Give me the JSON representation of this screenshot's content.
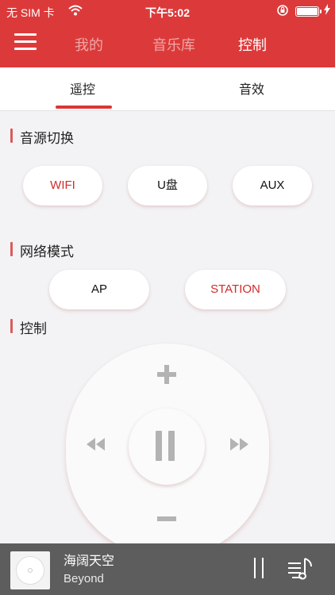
{
  "status_bar": {
    "carrier": "无 SIM 卡",
    "time": "下午5:02"
  },
  "top_nav": {
    "tabs": [
      "我的",
      "音乐库",
      "控制"
    ],
    "active_tab": "控制"
  },
  "sub_tabs": {
    "items": [
      "遥控",
      "音效"
    ],
    "active": "遥控"
  },
  "sections": {
    "source": {
      "title": "音源切换",
      "buttons": [
        "WIFI",
        "U盘",
        "AUX"
      ],
      "selected": "WIFI"
    },
    "network": {
      "title": "网络模式",
      "buttons": [
        "AP",
        "STATION"
      ],
      "selected": "STATION"
    },
    "control": {
      "title": "控制"
    }
  },
  "colors": {
    "brand": "#dc3a3a",
    "selected_text": "#d42a2a",
    "player_bg": "#5d5d5d"
  },
  "icons": {
    "menu": "hamburger-icon",
    "volume_up": "plus-icon",
    "volume_down": "minus-icon",
    "previous": "rewind-icon",
    "next": "fast-forward-icon",
    "play_pause": "pause-icon",
    "playlist": "playlist-icon"
  },
  "now_playing": {
    "title": "海阔天空",
    "artist": "Beyond"
  }
}
